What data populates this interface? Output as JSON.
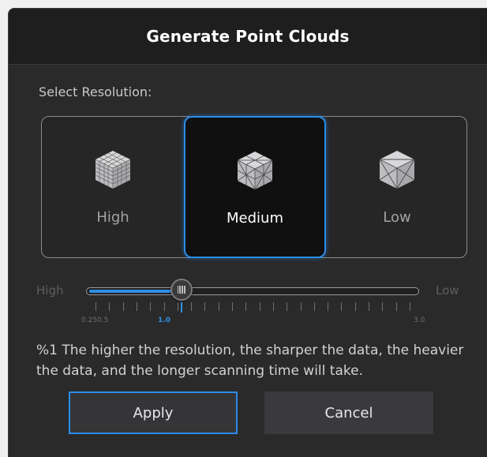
{
  "dialog": {
    "title": "Generate Point Clouds",
    "select_label": "Select Resolution:",
    "options": [
      {
        "label": "High",
        "icon": "dense-mesh-cube-icon"
      },
      {
        "label": "Medium",
        "icon": "medium-mesh-cube-icon",
        "selected": true
      },
      {
        "label": "Low",
        "icon": "coarse-mesh-cube-icon"
      }
    ],
    "slider": {
      "left_label": "High",
      "right_label": "Low",
      "min": 0.25,
      "max": 3.0,
      "value": 1.0,
      "tick_labels": [
        "0.25",
        "0.5",
        "1.0",
        "3.0"
      ],
      "selected_tick": "1.0"
    },
    "note": "%1 The higher the resolution, the sharper the data, the heavier the data, and the longer scanning time will take.",
    "apply_label": "Apply",
    "cancel_label": "Cancel",
    "colors": {
      "accent": "#2b8ce8",
      "background": "#2a2a2b",
      "titlebar": "#1e1e1f"
    }
  }
}
